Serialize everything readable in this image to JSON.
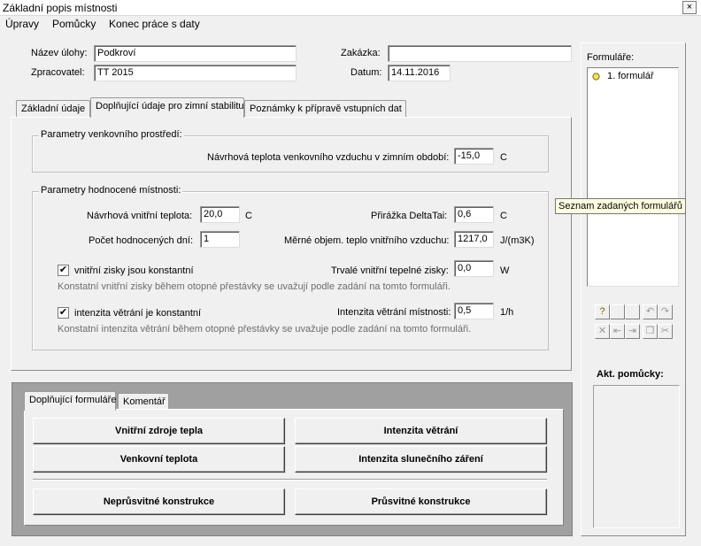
{
  "window": {
    "title": "Základní popis místnosti",
    "close": "×"
  },
  "menu": [
    "Úpravy",
    "Pomůcky",
    "Konec práce s daty"
  ],
  "header": {
    "task_label": "Název úlohy:",
    "task_value": "Podkroví",
    "processor_label": "Zpracovatel:",
    "processor_value": "TT 2015",
    "order_label": "Zakázka:",
    "order_value": "",
    "date_label": "Datum:",
    "date_value": "14.11.2016"
  },
  "tabs": [
    "Základní údaje",
    "Doplňující údaje pro zimní stabilitu",
    "Poznámky k přípravě vstupních dat"
  ],
  "outdoor": {
    "title": "Parametry venkovního prostředí:",
    "temp_label": "Návrhová teplota venkovního vzduchu v zimním období:",
    "temp_value": "-15,0",
    "temp_unit": "C"
  },
  "room": {
    "title": "Parametry hodnocené místnosti:",
    "inner_temp_label": "Návrhová vnitřní teplota:",
    "inner_temp_value": "20,0",
    "inner_temp_unit": "C",
    "days_label": "Počet hodnocených dní:",
    "days_value": "1",
    "delta_label": "Přirážka DeltaTai:",
    "delta_value": "0,6",
    "delta_unit": "C",
    "heat_label": "Měrné objem. teplo vnitřního vzduchu:",
    "heat_value": "1217,0",
    "heat_unit": "J/(m3K)",
    "gains_check_label": "vnitřní zisky jsou konstantní",
    "gains_label": "Trvalé vnitřní tepelné zisky:",
    "gains_value": "0,0",
    "gains_unit": "W",
    "gains_note": "Konstatní vnitřní zisky během otopné přestávky se uvažují podle zadání na tomto formuláři.",
    "vent_check_label": "intenzita větrání je konstantní",
    "vent_label": "Intenzita větrání místnosti:",
    "vent_value": "0,5",
    "vent_unit": "1/h",
    "vent_note": "Konstatní intenzita větrání během otopné přestávky se uvažuje podle zadání na tomto formuláři."
  },
  "bottom_tabs": [
    "Doplňující formuláře",
    "Komentář"
  ],
  "buttons": {
    "internal_sources": "Vnitřní zdroje tepla",
    "ventilation": "Intenzita větrání",
    "outdoor_temp": "Venkovní teplota",
    "solar": "Intenzita slunečního záření",
    "opaque": "Neprůsvitné konstrukce",
    "transparent": "Průsvitné konstrukce"
  },
  "side": {
    "forms_label": "Formuláře:",
    "forms": [
      "1. formulář"
    ],
    "tooltip": "Seznam zadaných formulářů",
    "tools_label": "Akt. pomůcky:"
  },
  "toolbar_icons": [
    "help-icon",
    "undo-icon",
    "redo-icon",
    "delete-icon",
    "move-first-icon",
    "move-last-icon",
    "copy-icon",
    "cut-icon"
  ],
  "checkmark": "✔"
}
